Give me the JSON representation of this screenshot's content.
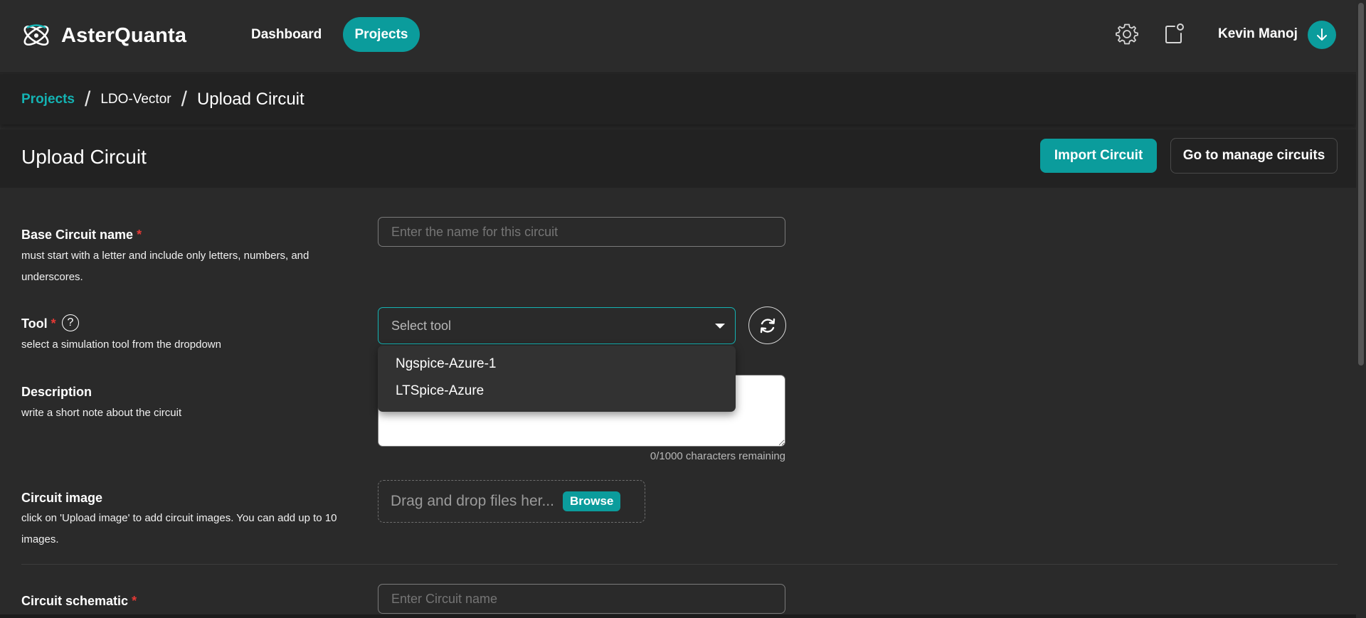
{
  "app": {
    "name": "AsterQuanta"
  },
  "nav": {
    "dashboard_label": "Dashboard",
    "projects_label": "Projects"
  },
  "header_icons": {
    "settings": "gear-icon",
    "notifications": "bell-notification-icon"
  },
  "user": {
    "name": "Kevin Manoj"
  },
  "breadcrumb": {
    "items": [
      "Projects",
      "LDO-Vector",
      "Upload Circuit"
    ]
  },
  "page": {
    "title": "Upload Circuit",
    "import_button": "Import Circuit",
    "manage_button": "Go to manage circuits"
  },
  "form": {
    "base_name": {
      "label": "Base Circuit name",
      "required_mark": "*",
      "help": "must start with a letter and include only letters, numbers, and underscores.",
      "placeholder": "Enter the name for this circuit"
    },
    "tool": {
      "label": "Tool",
      "required_mark": "*",
      "help_icon": "?",
      "help": "select a simulation tool from the dropdown",
      "placeholder": "Select tool",
      "options": [
        "Ngspice-Azure-1",
        "LTSpice-Azure"
      ]
    },
    "description": {
      "label": "Description",
      "help": "write a short note about the circuit",
      "char_count": "0/1000 characters remaining"
    },
    "circuit_image": {
      "label": "Circuit image",
      "help": "click on 'Upload image' to add circuit images. You can add up to 10 images.",
      "dropzone_text": "Drag and drop files her...",
      "browse_label": "Browse"
    },
    "circuit_schematic": {
      "label": "Circuit schematic",
      "required_mark": "*",
      "placeholder": "Enter Circuit name"
    }
  },
  "colors": {
    "accent": "#0b9c9c",
    "accent_text": "#14b3b3",
    "required": "#e53935",
    "background": "#2a2a2a"
  }
}
